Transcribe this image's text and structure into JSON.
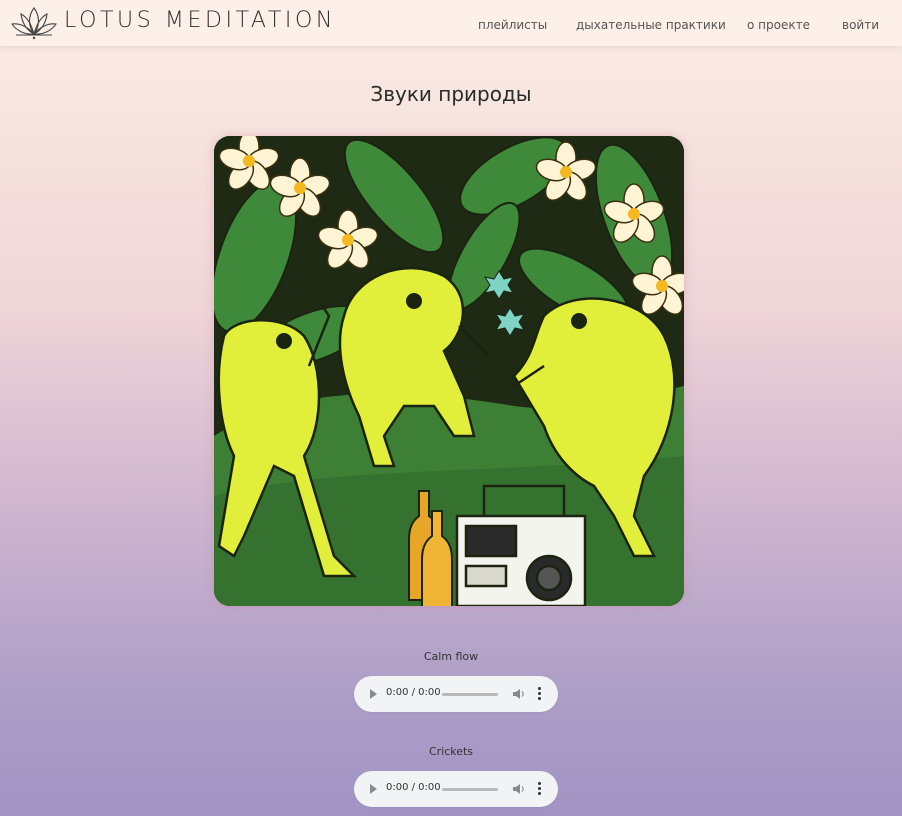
{
  "header": {
    "brand": "LOTUS MEDITATION",
    "nav": [
      "плейлисты",
      "дыхательные практики",
      "о проекте",
      "войти"
    ]
  },
  "main": {
    "title": "Звуки природы",
    "tracks": [
      {
        "title": "Calm flow",
        "time": "0:00 / 0:00"
      },
      {
        "title": "Crickets",
        "time": "0:00 / 0:00"
      }
    ]
  },
  "icons": {
    "logo": "lotus-icon",
    "play": "play-icon",
    "volume": "volume-icon",
    "more": "more-vertical-icon"
  },
  "colors": {
    "header_bg": "#fdf0e8",
    "player_bg": "#f1f3f4"
  }
}
